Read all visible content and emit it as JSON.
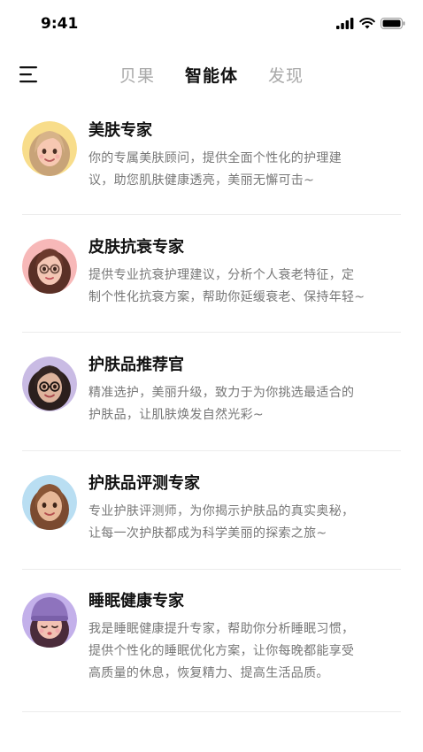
{
  "status": {
    "time": "9:41"
  },
  "nav": {
    "tabs": [
      {
        "label": "贝果"
      },
      {
        "label": "智能体"
      },
      {
        "label": "发现"
      }
    ]
  },
  "agents": [
    {
      "title": "美肤专家",
      "desc_lines": [
        "你的专属美肤顾问，提供全面个性化的护理建",
        "议，助您肌肤健康透亮，美丽无懈可击~"
      ]
    },
    {
      "title": "皮肤抗衰专家",
      "desc_lines": [
        "提供专业抗衰护理建议，分析个人衰老特征，定",
        "制个性化抗衰方案，帮助你延缓衰老、保持年轻~"
      ]
    },
    {
      "title": "护肤品推荐官",
      "desc_lines": [
        "精准选护，美丽升级，致力于为你挑选最适合的",
        "护肤品，让肌肤焕发自然光彩~"
      ]
    },
    {
      "title": "护肤品评测专家",
      "desc_lines": [
        "专业护肤评测师，为你揭示护肤品的真实奥秘，",
        "让每一次护肤都成为科学美丽的探索之旅~"
      ]
    },
    {
      "title": "睡眠健康专家",
      "desc_lines": [
        "我是睡眠健康提升专家，帮助你分析睡眠习惯，",
        "提供个性化的睡眠优化方案，让你每晚都能享受",
        "高质量的休息，恢复精力、提高生活品质。"
      ]
    }
  ]
}
